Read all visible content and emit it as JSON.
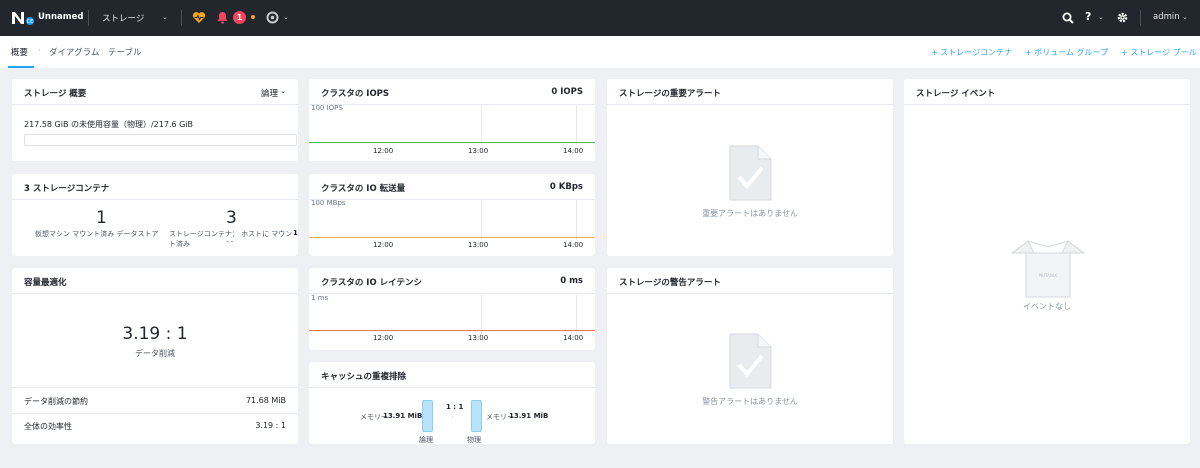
{
  "topbar": {
    "cluster_name": "Unnamed",
    "entity_label": "ストレージ",
    "alert_count": "1",
    "user": "admin",
    "colors": {
      "bar": "#22272e",
      "alert": "#f5445e",
      "health": "#f5a623",
      "dot": "#f5a623"
    }
  },
  "subnav": {
    "tabs": [
      "概要",
      "ダイアグラム",
      "テーブル"
    ],
    "actions": [
      "+ ストレージコンテナ",
      "+ ボリューム グループ",
      "+ ストレージ プール"
    ]
  },
  "storage_summary": {
    "title": "ストレージ 概要",
    "mode": "論理",
    "capacity_text": "217.58 GiB の未使用容量（物理）/217.6 GiB",
    "used_fraction": 0.0
  },
  "containers": {
    "title": "3 ストレージコンテナ",
    "stat1_value": "1",
    "stat1_label": "仮想マシン マウント済み データストア",
    "stat2_value": "3",
    "stat2_label_a": "ストレージコンテナ： ホストに マウント済み",
    "stat2_label_b": "1",
    "stat2_label_c": "- -"
  },
  "optimization": {
    "title": "容量最適化",
    "ratio": "3.19 : 1",
    "ratio_label": "データ削減",
    "rows": [
      {
        "label": "データ削減の節約",
        "value": "71.68 MiB"
      },
      {
        "label": "全体の効率性",
        "value": "3.19 : 1"
      }
    ]
  },
  "iops": {
    "title": "クラスタの IOPS",
    "value": "0 IOPS",
    "axis_label": "100 IOPS",
    "ticks": [
      "12:00",
      "13:00",
      "14:00"
    ],
    "line_color": "#5cb85c"
  },
  "throughput": {
    "title": "クラスタの IO 転送量",
    "value": "0 KBps",
    "axis_label": "100 MBps",
    "ticks": [
      "12:00",
      "13:00",
      "14:00"
    ],
    "line_color": "#f0ad4e"
  },
  "latency": {
    "title": "クラスタの IO レイテンシ",
    "value": "0 ms",
    "axis_label": "1 ms",
    "ticks": [
      "12:00",
      "13:00",
      "14:00"
    ],
    "line_color": "#e8764f"
  },
  "cache": {
    "title": "キャッシュの重複排除",
    "left_text": "メモリー",
    "left_value": "13.91 MiB",
    "ratio": "1 : 1",
    "right_text": "メモリー",
    "right_value": "13.91 MiB",
    "left_caption": "論理",
    "right_caption": "物理"
  },
  "critical_alerts": {
    "title": "ストレージの重要アラート",
    "empty": "重要アラートはありません"
  },
  "warning_alerts": {
    "title": "ストレージの警告アラート",
    "empty": "警告アラートはありません"
  },
  "events": {
    "title": "ストレージ イベント",
    "empty": "イベントなし",
    "box_text": "NUTANIX"
  }
}
